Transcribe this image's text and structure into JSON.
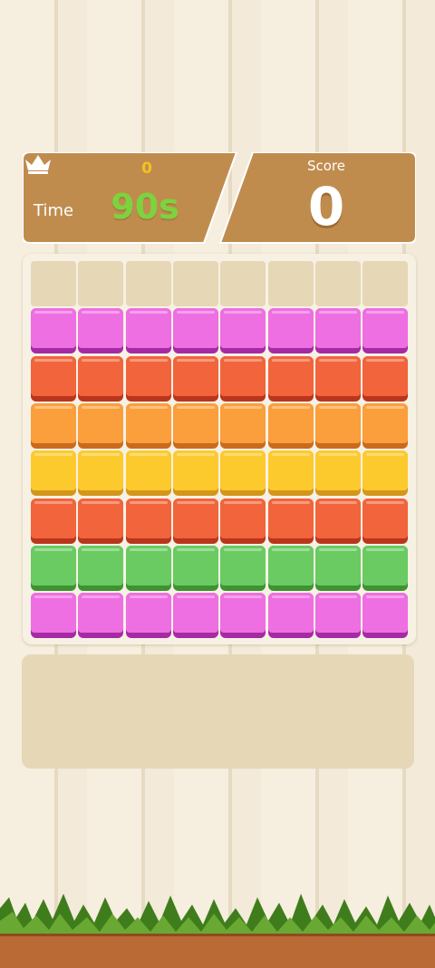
{
  "hud": {
    "best_score": "0",
    "time_label": "Time",
    "time_value": "90s",
    "score_label": "Score",
    "score_value": "0",
    "crown_icon": "crown-icon"
  },
  "board": {
    "columns": 8,
    "rows": 8,
    "grid": [
      [
        "empty",
        "empty",
        "empty",
        "empty",
        "empty",
        "empty",
        "empty",
        "empty"
      ],
      [
        "pink",
        "pink",
        "pink",
        "pink",
        "pink",
        "pink",
        "pink",
        "pink"
      ],
      [
        "red",
        "red",
        "red",
        "red",
        "red",
        "red",
        "red",
        "red"
      ],
      [
        "orange",
        "orange",
        "orange",
        "orange",
        "orange",
        "orange",
        "orange",
        "orange"
      ],
      [
        "yellow",
        "yellow",
        "yellow",
        "yellow",
        "yellow",
        "yellow",
        "yellow",
        "yellow"
      ],
      [
        "red",
        "red",
        "red",
        "red",
        "red",
        "red",
        "red",
        "red"
      ],
      [
        "green",
        "green",
        "green",
        "green",
        "green",
        "green",
        "green",
        "green"
      ],
      [
        "pink",
        "pink",
        "pink",
        "pink",
        "pink",
        "pink",
        "pink",
        "pink"
      ]
    ]
  },
  "colors": {
    "pink": {
      "top": "#ee6fe2",
      "side": "#a62aa4"
    },
    "red": {
      "top": "#f2643c",
      "side": "#b9361d"
    },
    "orange": {
      "top": "#fa9f3c",
      "side": "#cb6a1d"
    },
    "yellow": {
      "top": "#fdca2e",
      "side": "#d4961a"
    },
    "green": {
      "top": "#6acb63",
      "side": "#3f9233"
    },
    "panel": "#c08c4e",
    "time_green": "#7dd33d",
    "best_yellow": "#f4c21f"
  }
}
